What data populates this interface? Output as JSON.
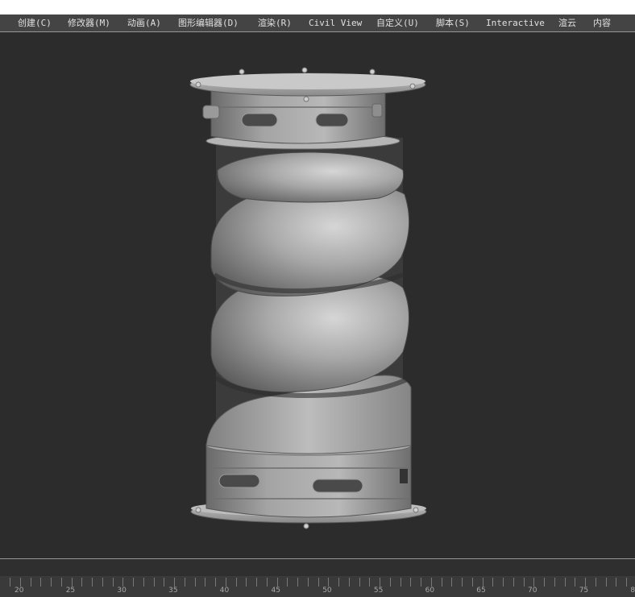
{
  "menu": {
    "items": [
      {
        "id": "create",
        "label": "创建(C)"
      },
      {
        "id": "modifiers",
        "label": "修改器(M)"
      },
      {
        "id": "animation",
        "label": "动画(A)"
      },
      {
        "id": "graph-editors",
        "label": "图形编辑器(D)"
      },
      {
        "id": "rendering",
        "label": "渲染(R)"
      },
      {
        "id": "civil-view",
        "label": "Civil View"
      },
      {
        "id": "customize",
        "label": "自定义(U)"
      },
      {
        "id": "scripting",
        "label": "脚本(S)"
      },
      {
        "id": "interactive",
        "label": "Interactive"
      },
      {
        "id": "render-cloud",
        "label": "渲云"
      },
      {
        "id": "content",
        "label": "内容"
      }
    ]
  },
  "timeline": {
    "labels": [
      "20",
      "25",
      "30",
      "35",
      "40",
      "45",
      "50",
      "55",
      "60",
      "65",
      "70",
      "75",
      "8"
    ]
  },
  "colors": {
    "viewport_bg": "#2c2c2c",
    "menu_bg": "#444444",
    "accent_line": "#b59a3c",
    "model_gray": "#9e9e9e"
  }
}
